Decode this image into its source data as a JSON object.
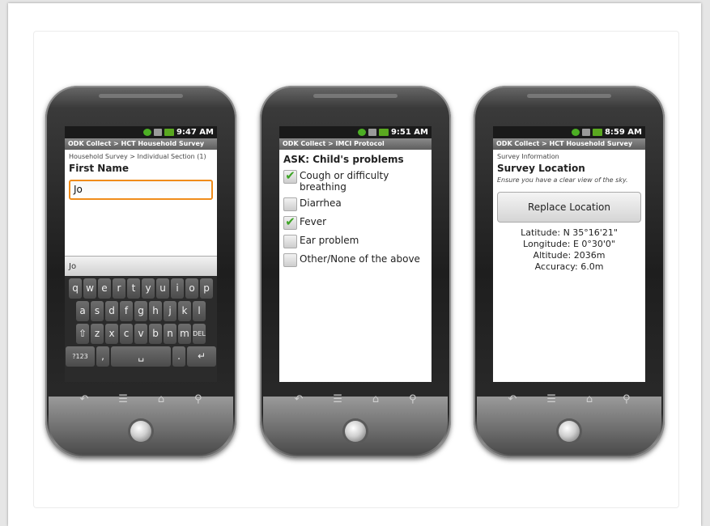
{
  "phones": [
    {
      "time": "9:47 AM",
      "title": "ODK Collect > HCT Household Survey",
      "breadcrumb": "Household Survey > Individual Section (1)",
      "question": "First Name",
      "input_value": "Jo",
      "suggestion": "Jo",
      "keyboard": {
        "row1": [
          "q",
          "w",
          "e",
          "r",
          "t",
          "y",
          "u",
          "i",
          "o",
          "p"
        ],
        "row2": [
          "a",
          "s",
          "d",
          "f",
          "g",
          "h",
          "j",
          "k",
          "l"
        ],
        "row3": [
          "⇧",
          "z",
          "x",
          "c",
          "v",
          "b",
          "n",
          "m",
          "DEL"
        ],
        "row4": [
          "?123",
          ",",
          "␣",
          ".",
          "↵"
        ]
      }
    },
    {
      "time": "9:51 AM",
      "title": "ODK Collect > IMCI Protocol",
      "question": "ASK: Child's problems",
      "options": [
        {
          "label": "Cough or difficulty breathing",
          "checked": true
        },
        {
          "label": "Diarrhea",
          "checked": false
        },
        {
          "label": "Fever",
          "checked": true
        },
        {
          "label": "Ear problem",
          "checked": false
        },
        {
          "label": "Other/None of the above",
          "checked": false
        }
      ]
    },
    {
      "time": "8:59 AM",
      "title": "ODK Collect > HCT Household Survey",
      "breadcrumb": "Survey Information",
      "question": "Survey Location",
      "hint": "Ensure you have a clear view of the sky.",
      "button_label": "Replace Location",
      "latitude": "Latitude: N 35°16'21\"",
      "longitude": "Longitude: E 0°30'0\"",
      "altitude": "Altitude: 2036m",
      "accuracy": "Accuracy: 6.0m"
    }
  ],
  "softkeys": [
    "↶",
    "☰",
    "⌂",
    "⚲"
  ],
  "colors": {
    "focus": "#f08c1a",
    "check": "#3da425",
    "statusbar": "#1a1a1a"
  }
}
